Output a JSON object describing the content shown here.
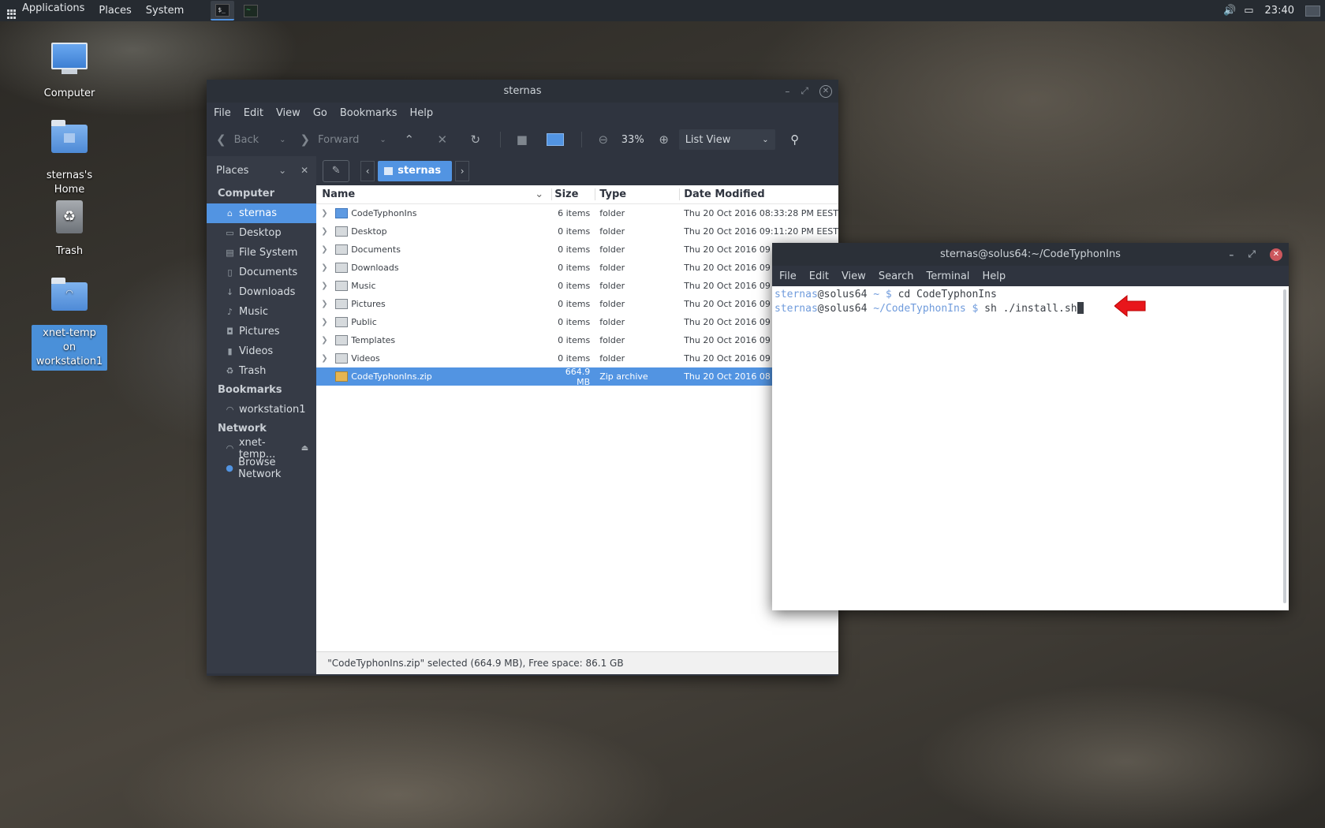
{
  "top_panel": {
    "menus": [
      "Applications",
      "Places",
      "System"
    ],
    "terminal_task_glyph": "$_",
    "monitor_task_glyph": "~",
    "clock": "23:40",
    "icons": {
      "volume": "speaker-icon",
      "display": "screen-icon"
    }
  },
  "desktop_icons": [
    {
      "label": "Computer",
      "icon": "computer-icon"
    },
    {
      "label": "sternas's Home",
      "icon": "home-folder-icon"
    },
    {
      "label": "Trash",
      "icon": "trash-icon"
    },
    {
      "label": "xnet-temp on workstation1",
      "icon": "network-folder-icon",
      "selected": true
    }
  ],
  "file_manager": {
    "title": "sternas",
    "menu": [
      "File",
      "Edit",
      "View",
      "Go",
      "Bookmarks",
      "Help"
    ],
    "toolbar": {
      "back": "Back",
      "forward": "Forward",
      "zoom": "33%",
      "view_mode": "List View"
    },
    "sidebar": {
      "header": "Places",
      "sections": {
        "computer": "Computer",
        "bookmarks": "Bookmarks",
        "network": "Network"
      },
      "computer_items": [
        "sternas",
        "Desktop",
        "File System",
        "Documents",
        "Downloads",
        "Music",
        "Pictures",
        "Videos",
        "Trash"
      ],
      "bookmark_items": [
        "workstation1"
      ],
      "network_items": [
        "xnet-temp...",
        "Browse Network"
      ]
    },
    "pathbar": {
      "crumb": "sternas"
    },
    "columns": {
      "name": "Name",
      "size": "Size",
      "type": "Type",
      "date": "Date Modified"
    },
    "rows": [
      {
        "name": "CodeTyphonIns",
        "size": "6 items",
        "type": "folder",
        "date": "Thu 20 Oct 2016 08:33:28 PM EEST"
      },
      {
        "name": "Desktop",
        "size": "0 items",
        "type": "folder",
        "date": "Thu 20 Oct 2016 09:11:20 PM EEST"
      },
      {
        "name": "Documents",
        "size": "0 items",
        "type": "folder",
        "date": "Thu 20 Oct 2016 09"
      },
      {
        "name": "Downloads",
        "size": "0 items",
        "type": "folder",
        "date": "Thu 20 Oct 2016 09"
      },
      {
        "name": "Music",
        "size": "0 items",
        "type": "folder",
        "date": "Thu 20 Oct 2016 09"
      },
      {
        "name": "Pictures",
        "size": "0 items",
        "type": "folder",
        "date": "Thu 20 Oct 2016 09"
      },
      {
        "name": "Public",
        "size": "0 items",
        "type": "folder",
        "date": "Thu 20 Oct 2016 09"
      },
      {
        "name": "Templates",
        "size": "0 items",
        "type": "folder",
        "date": "Thu 20 Oct 2016 09"
      },
      {
        "name": "Videos",
        "size": "0 items",
        "type": "folder",
        "date": "Thu 20 Oct 2016 09"
      },
      {
        "name": "CodeTyphonIns.zip",
        "size": "664.9 MB",
        "type": "Zip archive",
        "date": "Thu 20 Oct 2016 08"
      }
    ],
    "status": "\"CodeTyphonIns.zip\" selected (664.9 MB), Free space: 86.1 GB"
  },
  "terminal": {
    "title": "sternas@solus64:~/CodeTyphonIns",
    "menu": [
      "File",
      "Edit",
      "View",
      "Search",
      "Terminal",
      "Help"
    ],
    "lines": [
      {
        "user": "sternas",
        "host": "@solus64",
        "path": " ~ $ ",
        "cmd": "cd CodeTyphonIns"
      },
      {
        "user": "sternas",
        "host": "@solus64",
        "path": " ~/CodeTyphonIns $ ",
        "cmd": "sh ./install.sh"
      }
    ],
    "annotation_color": "#e8161b"
  },
  "colors": {
    "accent": "#5294e2",
    "panel": "#262b31",
    "window": "#2f343f"
  }
}
